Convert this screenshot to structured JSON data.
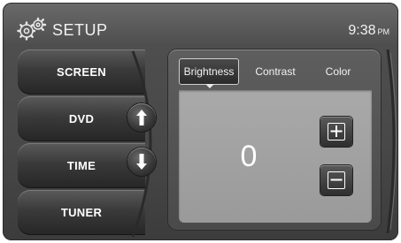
{
  "header": {
    "title": "SETUP",
    "time": "9:38",
    "ampm": "PM",
    "icon": "gears-icon"
  },
  "menu": {
    "items": [
      {
        "label": "SCREEN"
      },
      {
        "label": "DVD"
      },
      {
        "label": "TIME"
      },
      {
        "label": "TUNER"
      }
    ],
    "scroll_up_icon": "arrow-up-icon",
    "scroll_down_icon": "arrow-down-icon"
  },
  "tabs": {
    "items": [
      {
        "label": "Brightness",
        "active": true
      },
      {
        "label": "Contrast",
        "active": false
      },
      {
        "label": "Color",
        "active": false
      }
    ]
  },
  "adjust": {
    "value": "0",
    "increase_icon": "plus-icon",
    "decrease_icon": "minus-icon"
  },
  "colors": {
    "background": "#4e4e4e",
    "content": "#a9a9a9",
    "text": "#ffffff"
  }
}
